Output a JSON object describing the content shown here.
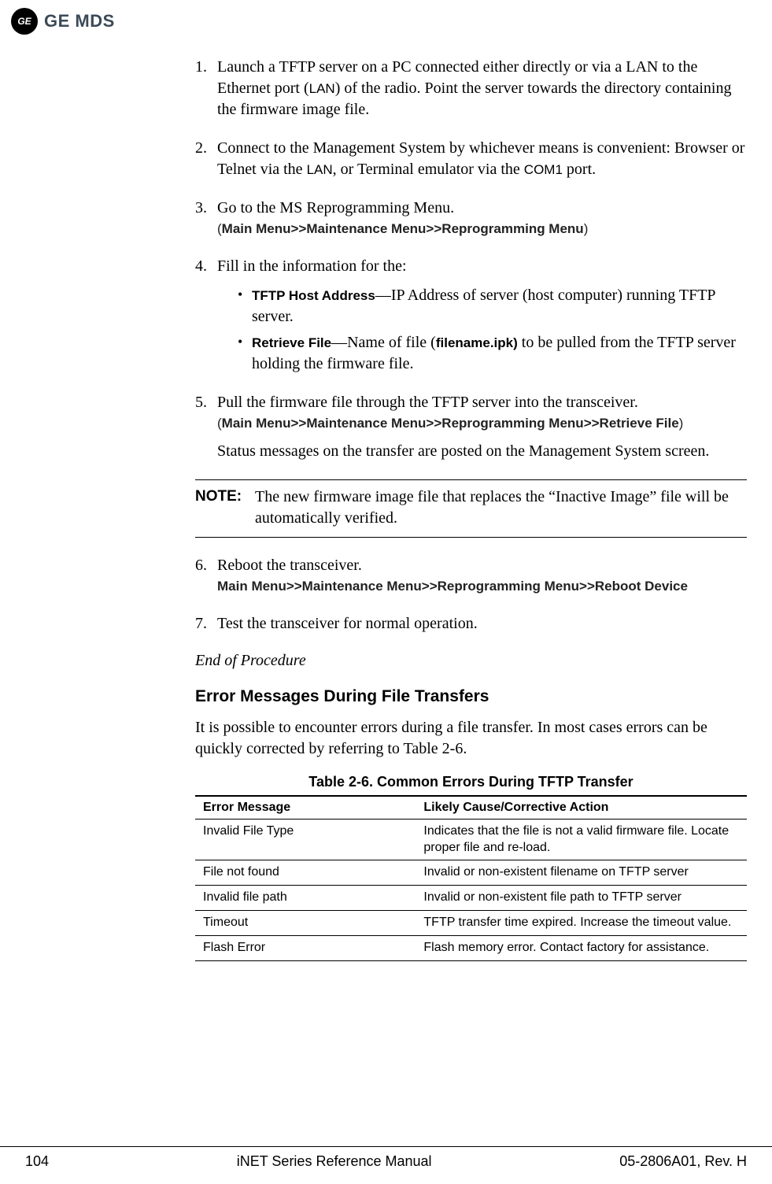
{
  "header": {
    "brand": "GE MDS",
    "badge": "GE"
  },
  "steps": {
    "s1": "Launch a TFTP server on a PC connected either directly or via a LAN to the Ethernet port (",
    "s1_lan": "LAN",
    "s1_tail": ") of the radio. Point the server towards the directory containing the firmware image file.",
    "s2a": "Connect to the Management System by whichever means is convenient: Browser or Telnet via the ",
    "s2_lan": "LAN",
    "s2b": ", or Terminal emulator via the ",
    "s2_com1": "COM1",
    "s2c": " port.",
    "s3": "Go to the MS Reprogramming Menu.",
    "s3_path": "Main Menu>>Maintenance Menu>>Reprogramming Menu",
    "s4": "Fill in the information for the:",
    "s4_b1_label": "TFTP Host Address",
    "s4_b1_text": "—IP Address of server (host computer) running TFTP server.",
    "s4_b2_label": "Retrieve File",
    "s4_b2_a": "—Name of file (",
    "s4_b2_file": "filename.ipk)",
    "s4_b2_b": " to be pulled from the TFTP server holding the firmware file.",
    "s5": "Pull the firmware file through the TFTP server into the transceiver.",
    "s5_path": "Main Menu>>Maintenance Menu>>Reprogramming Menu>>Retrieve File",
    "s5_status": "Status messages on the transfer are posted on the Management System screen.",
    "s6": "Reboot the transceiver.",
    "s6_path": "Main Menu>>Maintenance Menu>>Reprogramming Menu>>Reboot Device",
    "s7": "Test the transceiver for normal operation."
  },
  "note": {
    "label": "NOTE:",
    "text": "The new firmware image file that replaces the “Inactive Image” file will be automatically verified."
  },
  "end_text": "End of Procedure",
  "section": {
    "heading": "Error Messages During File Transfers",
    "intro": "It is possible to encounter errors during a file transfer. In most cases errors can be quickly corrected by referring to Table 2-6."
  },
  "table": {
    "title": "Table 2-6. Common Errors During TFTP Transfer",
    "headers": {
      "msg": "Error Message",
      "cause": "Likely Cause/Corrective Action"
    },
    "rows": [
      {
        "msg": "Invalid File Type",
        "cause": "Indicates that the file is not a valid firmware file. Locate proper file and re-load."
      },
      {
        "msg": "File not found",
        "cause": "Invalid or non-existent filename on TFTP server"
      },
      {
        "msg": "Invalid file path",
        "cause": "Invalid or non-existent file path to TFTP server"
      },
      {
        "msg": "Timeout",
        "cause": "TFTP transfer time expired. Increase the timeout value."
      },
      {
        "msg": "Flash Error",
        "cause": "Flash memory error. Contact factory for assistance."
      }
    ]
  },
  "footer": {
    "page": "104",
    "center": "iNET Series Reference Manual",
    "right": "05-2806A01, Rev. H"
  }
}
